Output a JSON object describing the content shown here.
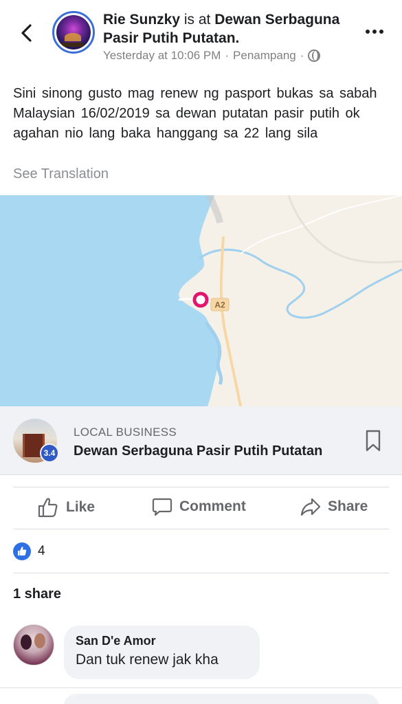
{
  "header": {
    "author": "Rie Sunzky",
    "connector": " is at ",
    "place": "Dewan Serbaguna Pasir Putih Putatan.",
    "time": "Yesterday at 10:06 PM",
    "location": "Penampang",
    "separator": "·",
    "icons": {
      "back": "chevron-left-icon",
      "privacy": "globe-icon",
      "more": "more-horizontal-icon"
    }
  },
  "post": {
    "text": "Sini sinong gusto  mag  renew  ng  pasport  bukas sa sabah  Malaysian  16/02/2019 sa  dewan  putatan pasir  putih ok agahan  nio lang baka hanggang sa  22 lang  sila",
    "see_translation": "See Translation"
  },
  "map": {
    "road_label": "A2",
    "colors": {
      "sea": "#a9d8f2",
      "land": "#f5f1e9",
      "river": "#9fd0ee",
      "road": "#f7d7a6",
      "pin": "#e0166e"
    }
  },
  "business": {
    "kind": "LOCAL BUSINESS",
    "name": "Dewan Serbaguna Pasir Putih Putatan",
    "rating": "3.4",
    "icons": {
      "save": "bookmark-icon"
    }
  },
  "actions": {
    "like": "Like",
    "comment": "Comment",
    "share": "Share",
    "icons": {
      "like": "thumbs-up-icon",
      "comment": "comment-icon",
      "share": "share-arrow-icon"
    }
  },
  "reactions": {
    "count": "4",
    "icon": "like-reaction-icon",
    "color": "#2f6fe4"
  },
  "shares": {
    "label": "1 share"
  },
  "comments": [
    {
      "author": "San D'e Amor",
      "text": "Dan tuk renew jak kha"
    }
  ]
}
